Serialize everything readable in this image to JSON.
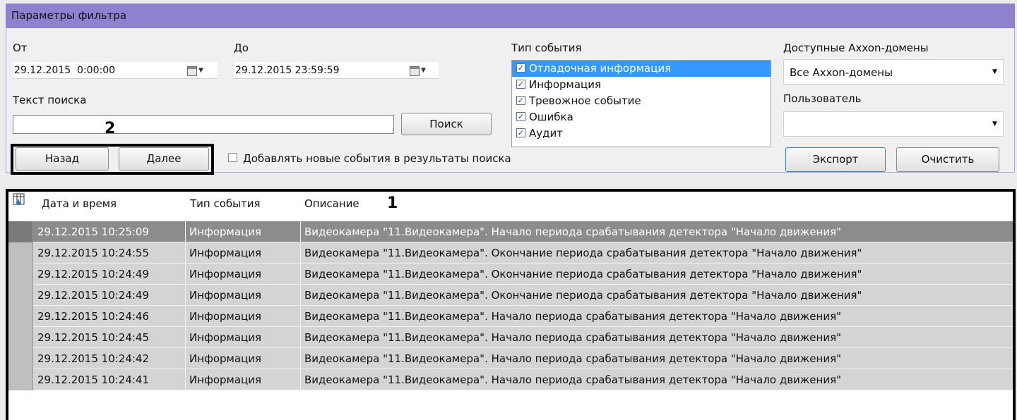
{
  "panel": {
    "title": "Параметры фильтра"
  },
  "from": {
    "label": "От",
    "value": "29.12.2015  0:00:00"
  },
  "to": {
    "label": "До",
    "value": "29.12.2015 23:59:59"
  },
  "search": {
    "label": "Текст поиска",
    "value": "",
    "button": "Поиск"
  },
  "nav": {
    "back": "Назад",
    "next": "Далее"
  },
  "append_checkbox": {
    "label": "Добавлять новые события в результаты поиска",
    "checked": false
  },
  "event_type": {
    "label": "Тип события",
    "items": [
      {
        "label": "Отладочная информация",
        "checked": true,
        "selected": true
      },
      {
        "label": "Информация",
        "checked": true
      },
      {
        "label": "Тревожное событие",
        "checked": true
      },
      {
        "label": "Ошибка",
        "checked": true
      },
      {
        "label": "Аудит",
        "checked": true
      }
    ]
  },
  "domains": {
    "label": "Доступные Axxon-домены",
    "value": "Все Axxon-домены"
  },
  "user": {
    "label": "Пользователь",
    "value": ""
  },
  "actions": {
    "export": "Экспорт",
    "clear": "Очистить"
  },
  "annotations": {
    "one": "1",
    "two": "2"
  },
  "grid": {
    "columns": [
      "Дата и время",
      "Тип события",
      "Описание"
    ],
    "rows": [
      {
        "datetime": "29.12.2015 10:25:09",
        "type": "Информация",
        "description": "Видеокамера \"11.Видеокамера\". Начало периода срабатывания детектора \"Начало движения\"",
        "selected": true
      },
      {
        "datetime": "29.12.2015 10:24:55",
        "type": "Информация",
        "description": "Видеокамера \"11.Видеокамера\". Окончание периода срабатывания детектора \"Начало движения\""
      },
      {
        "datetime": "29.12.2015 10:24:49",
        "type": "Информация",
        "description": "Видеокамера \"11.Видеокамера\". Окончание периода срабатывания детектора \"Начало движения\""
      },
      {
        "datetime": "29.12.2015 10:24:49",
        "type": "Информация",
        "description": "Видеокамера \"11.Видеокамера\". Окончание периода срабатывания детектора \"Начало движения\""
      },
      {
        "datetime": "29.12.2015 10:24:46",
        "type": "Информация",
        "description": "Видеокамера \"11.Видеокамера\". Начало периода срабатывания детектора \"Начало движения\""
      },
      {
        "datetime": "29.12.2015 10:24:45",
        "type": "Информация",
        "description": "Видеокамера \"11.Видеокамера\". Начало периода срабатывания детектора \"Начало движения\""
      },
      {
        "datetime": "29.12.2015 10:24:42",
        "type": "Информация",
        "description": "Видеокамера \"11.Видеокамера\". Начало периода срабатывания детектора \"Начало движения\""
      },
      {
        "datetime": "29.12.2015 10:24:41",
        "type": "Информация",
        "description": "Видеокамера \"11.Видеокамера\". Начало периода срабатывания детектора \"Начало движения\""
      }
    ]
  }
}
